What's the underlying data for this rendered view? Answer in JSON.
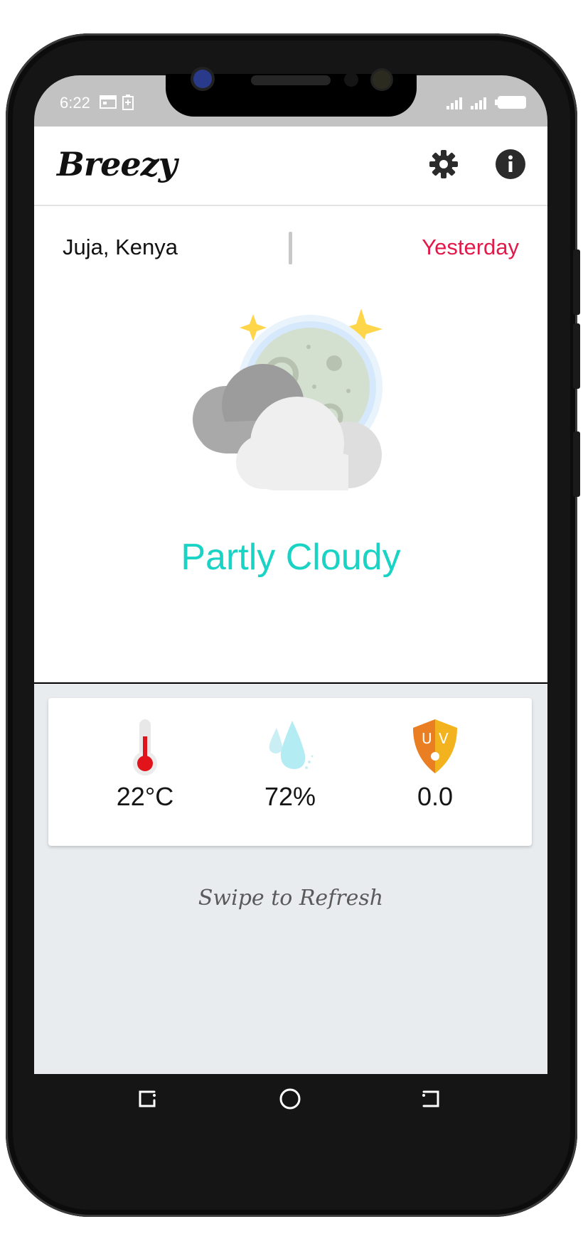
{
  "status_bar": {
    "time": "6:22"
  },
  "app": {
    "title": "Breezy"
  },
  "location": {
    "name": "Juja, Kenya",
    "timeframe": "Yesterday"
  },
  "weather": {
    "condition": "Partly Cloudy",
    "icon": "partly-cloudy-night-icon"
  },
  "stats": {
    "temperature": {
      "value": "22°C",
      "icon": "thermometer-icon"
    },
    "humidity": {
      "value": "72%",
      "icon": "water-drops-icon"
    },
    "uv": {
      "value": "0.0",
      "icon": "uv-shield-icon",
      "badge": "UV"
    }
  },
  "hint": "Swipe to Refresh",
  "colors": {
    "accent_teal": "#19d3c5",
    "timeframe_red": "#e3194a",
    "background_grey": "#e8ecef",
    "status_bar_grey": "#c2c2c2"
  }
}
